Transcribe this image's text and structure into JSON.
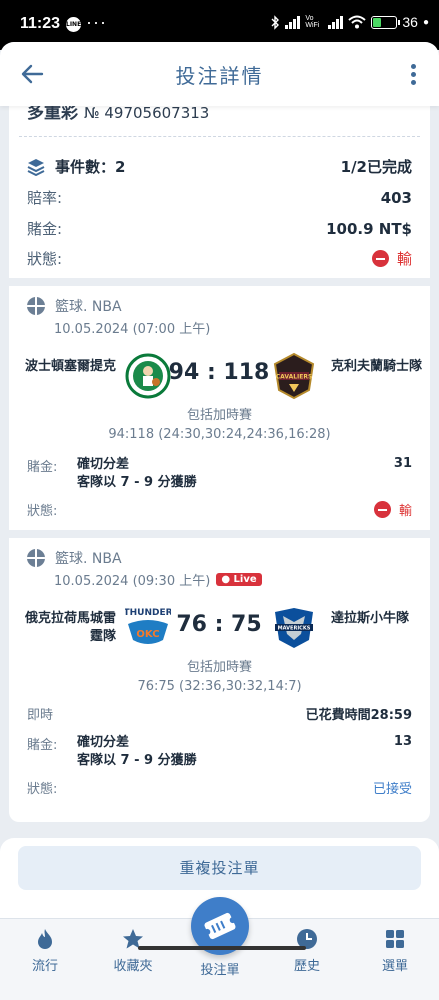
{
  "status_bar": {
    "time": "11:23",
    "line_badge": "LINE",
    "more": "···",
    "wifi_label": "Vo WiFi",
    "battery": "36",
    "battery_level": 0.36
  },
  "header": {
    "title": "投注詳情"
  },
  "ticket": {
    "title": "多重彩",
    "number": "№ 49705607313"
  },
  "summary": {
    "events_label": "事件數：2",
    "progress": "1/2已完成",
    "odds_label": "賠率:",
    "odds_value": "403",
    "stake_label": "賭金:",
    "stake_value": "100.9 NT$",
    "status_label": "狀態:",
    "status_value": "輸"
  },
  "events": [
    {
      "sport": "籃球. NBA",
      "datetime": "10.05.2024 (07:00 上午)",
      "home_team": "波士頓塞爾提克",
      "away_team": "克利夫蘭騎士隊",
      "score": "94 : 118",
      "ot_note": "包括加時賽",
      "period_scores": "94:118 (24:30,30:24,24:36,16:28)",
      "stake_label": "賭金:",
      "market": "確切分差",
      "selection": "客隊以 7 - 9 分獲勝",
      "odds": "31",
      "status_label": "狀態:",
      "status_value": "輸"
    },
    {
      "sport": "籃球. NBA",
      "datetime": "10.05.2024 (09:30 上午)",
      "live_badge": "Live",
      "home_team": "俄克拉荷馬城雷霆隊",
      "away_team": "達拉斯小牛隊",
      "score": "76 : 75",
      "ot_note": "包括加時賽",
      "period_scores": "76:75 (32:36,30:32,14:7)",
      "live_label": "即時",
      "elapsed": "已花費時間28:59",
      "stake_label": "賭金:",
      "market": "確切分差",
      "selection": "客隊以 7 - 9 分獲勝",
      "odds": "13",
      "status_label": "狀態:",
      "status_value": "已接受"
    }
  ],
  "repeat_button": "重複投注單",
  "bottom_nav": {
    "hot": "流行",
    "favorites": "收藏夾",
    "betslip": "投注單",
    "history": "歷史",
    "menu": "選單"
  },
  "colors": {
    "accent": "#3f6a97",
    "primary": "#3f7ec9",
    "lose": "#d8323c",
    "background": "#e9edf2"
  },
  "icons": {
    "back": "arrow-left-icon",
    "more": "more-vertical-icon",
    "events": "layers-icon",
    "sport": "basketball-icon",
    "lose": "minus-circle-icon",
    "nav_hot": "fire-icon",
    "nav_favorites": "star-icon",
    "nav_betslip": "ticket-icon",
    "nav_history": "clock-icon",
    "nav_menu": "grid-icon"
  }
}
